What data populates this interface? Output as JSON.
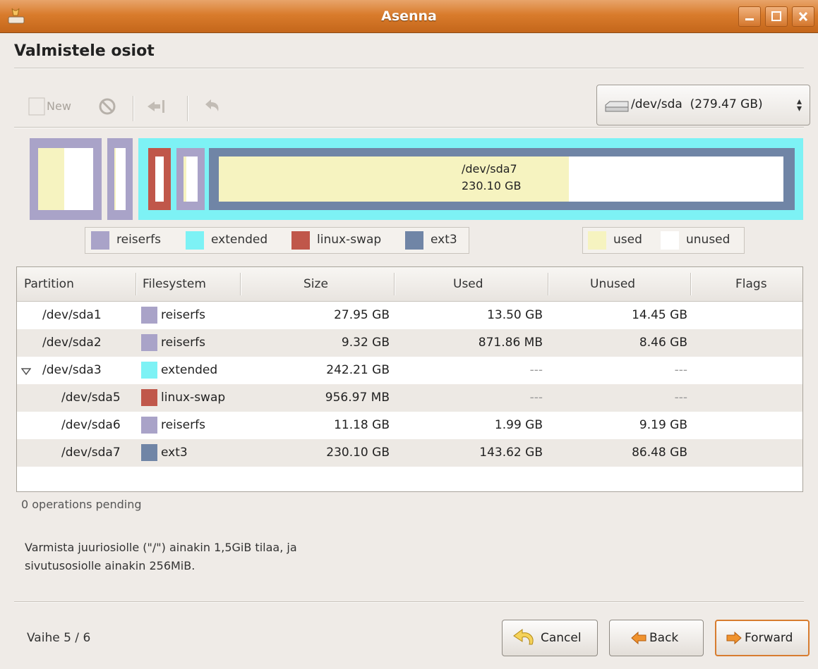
{
  "window": {
    "title": "Asenna"
  },
  "page": {
    "heading": "Valmistele osiot"
  },
  "toolbar": {
    "new_label": "New",
    "device_label": "/dev/sda  (279.47 GB)",
    "device_arrows": "⬍"
  },
  "graph": {
    "selected_name": "/dev/sda7",
    "selected_size": "230.10 GB",
    "partitions": [
      {
        "name": "/dev/sda1",
        "fs": "reiserfs",
        "used_fraction": 0.48
      },
      {
        "name": "/dev/sda2",
        "fs": "reiserfs",
        "used_fraction": 0.09
      },
      {
        "name": "/dev/sda3",
        "fs": "extended"
      },
      {
        "name": "/dev/sda5",
        "fs": "linux-swap",
        "used_fraction": 0.0
      },
      {
        "name": "/dev/sda6",
        "fs": "reiserfs",
        "used_fraction": 0.18
      },
      {
        "name": "/dev/sda7",
        "fs": "ext3",
        "used_fraction": 0.62
      }
    ]
  },
  "legend": {
    "fs": [
      {
        "label": "reiserfs",
        "color": "#a9a3c8"
      },
      {
        "label": "extended",
        "color": "#7df2f5"
      },
      {
        "label": "linux-swap",
        "color": "#c0574a"
      },
      {
        "label": "ext3",
        "color": "#7085a6"
      }
    ],
    "usage": [
      {
        "label": "used",
        "color": "#f6f3c0"
      },
      {
        "label": "unused",
        "color": "#ffffff"
      }
    ]
  },
  "table": {
    "columns": [
      "Partition",
      "Filesystem",
      "Size",
      "Used",
      "Unused",
      "Flags"
    ],
    "rows": [
      {
        "partition": "/dev/sda1",
        "filesystem": "reiserfs",
        "size": "27.95 GB",
        "used": "13.50 GB",
        "unused": "14.45 GB",
        "flags": "",
        "color": "#a9a3c8"
      },
      {
        "partition": "/dev/sda2",
        "filesystem": "reiserfs",
        "size": "9.32 GB",
        "used": "871.86 MB",
        "unused": "8.46 GB",
        "flags": "",
        "color": "#a9a3c8"
      },
      {
        "partition": "/dev/sda3",
        "filesystem": "extended",
        "size": "242.21 GB",
        "used": "---",
        "unused": "---",
        "flags": "",
        "color": "#7df2f5"
      },
      {
        "partition": "/dev/sda5",
        "filesystem": "linux-swap",
        "size": "956.97 MB",
        "used": "---",
        "unused": "---",
        "flags": "",
        "color": "#c0574a"
      },
      {
        "partition": "/dev/sda6",
        "filesystem": "reiserfs",
        "size": "11.18 GB",
        "used": "1.99 GB",
        "unused": "9.19 GB",
        "flags": "",
        "color": "#a9a3c8"
      },
      {
        "partition": "/dev/sda7",
        "filesystem": "ext3",
        "size": "230.10 GB",
        "used": "143.62 GB",
        "unused": "86.48 GB",
        "flags": "",
        "color": "#7085a6"
      }
    ]
  },
  "status": {
    "pending": "0 operations pending",
    "note_line1": "Varmista juuriosiolle (\"/\") ainakin 1,5GiB tilaa, ja",
    "note_line2": "sivutusosiolle ainakin 256MiB."
  },
  "footer": {
    "step": "Vaihe 5 / 6",
    "cancel_label": "Cancel",
    "back_label": "Back",
    "forward_label": "Forward"
  }
}
